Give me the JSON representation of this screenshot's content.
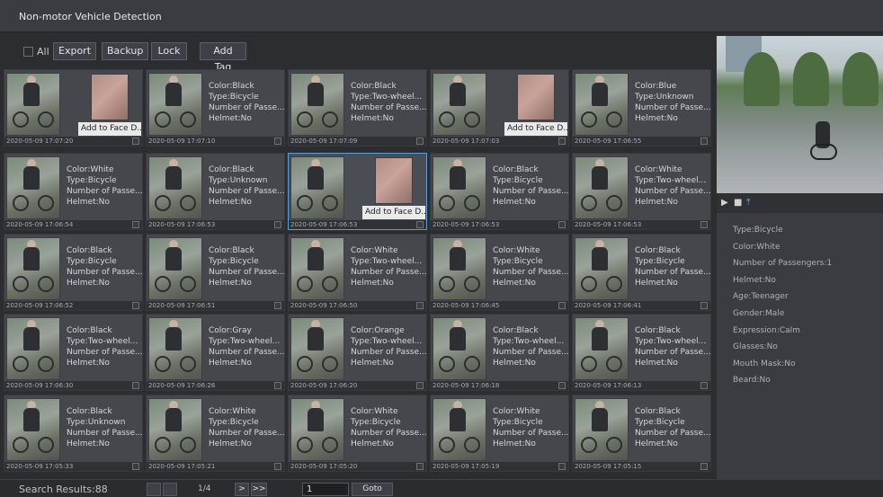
{
  "window": {
    "title": "Non-motor Vehicle Detection"
  },
  "toolbar": {
    "all_label": "All",
    "export_label": "Export",
    "backup_label": "Backup",
    "lock_label": "Lock",
    "add_tag_label": "Add Tag"
  },
  "grid": {
    "cells": [
      {
        "ts": "2020-05-09 17:07:20",
        "face": true,
        "face_label": "Add to Face D...",
        "info": []
      },
      {
        "ts": "2020-05-09 17:07:10",
        "face": false,
        "info": [
          "Color:Black",
          "Type:Bicycle",
          "Number of Passe...",
          "Helmet:No"
        ]
      },
      {
        "ts": "2020-05-09 17:07:09",
        "face": false,
        "info": [
          "Color:Black",
          "Type:Two-wheel...",
          "Number of Passe...",
          "Helmet:No"
        ]
      },
      {
        "ts": "2020-05-09 17:07:03",
        "face": true,
        "face_label": "Add to Face D...",
        "info": []
      },
      {
        "ts": "2020-05-09 17:06:55",
        "face": false,
        "info": [
          "Color:Blue",
          "Type:Unknown",
          "Number of Passe...",
          "Helmet:No"
        ]
      },
      {
        "ts": "2020-05-09 17:06:54",
        "face": false,
        "info": [
          "Color:White",
          "Type:Bicycle",
          "Number of Passe...",
          "Helmet:No"
        ]
      },
      {
        "ts": "2020-05-09 17:06:53",
        "face": false,
        "info": [
          "Color:Black",
          "Type:Unknown",
          "Number of Passe...",
          "Helmet:No"
        ]
      },
      {
        "ts": "2020-05-09 17:06:53",
        "face": true,
        "face_label": "Add to Face D...",
        "info": [],
        "selected": true
      },
      {
        "ts": "2020-05-09 17:06:53",
        "face": false,
        "info": [
          "Color:Black",
          "Type:Bicycle",
          "Number of Passe...",
          "Helmet:No"
        ]
      },
      {
        "ts": "2020-05-09 17:06:53",
        "face": false,
        "info": [
          "Color:White",
          "Type:Two-wheel...",
          "Number of Passe...",
          "Helmet:No"
        ]
      },
      {
        "ts": "2020-05-09 17:06:52",
        "face": false,
        "info": [
          "Color:Black",
          "Type:Bicycle",
          "Number of Passe...",
          "Helmet:No"
        ]
      },
      {
        "ts": "2020-05-09 17:06:51",
        "face": false,
        "info": [
          "Color:Black",
          "Type:Bicycle",
          "Number of Passe...",
          "Helmet:No"
        ]
      },
      {
        "ts": "2020-05-09 17:06:50",
        "face": false,
        "info": [
          "Color:White",
          "Type:Two-wheel...",
          "Number of Passe...",
          "Helmet:No"
        ]
      },
      {
        "ts": "2020-05-09 17:06:45",
        "face": false,
        "info": [
          "Color:White",
          "Type:Bicycle",
          "Number of Passe...",
          "Helmet:No"
        ]
      },
      {
        "ts": "2020-05-09 17:06:41",
        "face": false,
        "info": [
          "Color:Black",
          "Type:Bicycle",
          "Number of Passe...",
          "Helmet:No"
        ]
      },
      {
        "ts": "2020-05-09 17:06:30",
        "face": false,
        "info": [
          "Color:Black",
          "Type:Two-wheel...",
          "Number of Passe...",
          "Helmet:No"
        ]
      },
      {
        "ts": "2020-05-09 17:06:26",
        "face": false,
        "info": [
          "Color:Gray",
          "Type:Two-wheel...",
          "Number of Passe...",
          "Helmet:No"
        ]
      },
      {
        "ts": "2020-05-09 17:06:20",
        "face": false,
        "info": [
          "Color:Orange",
          "Type:Two-wheel...",
          "Number of Passe...",
          "Helmet:No"
        ]
      },
      {
        "ts": "2020-05-09 17:06:18",
        "face": false,
        "info": [
          "Color:Black",
          "Type:Two-wheel...",
          "Number of Passe...",
          "Helmet:No"
        ]
      },
      {
        "ts": "2020-05-09 17:06:13",
        "face": false,
        "info": [
          "Color:Black",
          "Type:Two-wheel...",
          "Number of Passe...",
          "Helmet:No"
        ]
      },
      {
        "ts": "2020-05-09 17:05:33",
        "face": false,
        "info": [
          "Color:Black",
          "Type:Unknown",
          "Number of Passe...",
          "Helmet:No"
        ]
      },
      {
        "ts": "2020-05-09 17:05:21",
        "face": false,
        "info": [
          "Color:White",
          "Type:Bicycle",
          "Number of Passe...",
          "Helmet:No"
        ]
      },
      {
        "ts": "2020-05-09 17:05:20",
        "face": false,
        "info": [
          "Color:White",
          "Type:Bicycle",
          "Number of Passe...",
          "Helmet:No"
        ]
      },
      {
        "ts": "2020-05-09 17:05:19",
        "face": false,
        "info": [
          "Color:White",
          "Type:Bicycle",
          "Number of Passe...",
          "Helmet:No"
        ]
      },
      {
        "ts": "2020-05-09 17:05:15",
        "face": false,
        "info": [
          "Color:Black",
          "Type:Bicycle",
          "Number of Passe...",
          "Helmet:No"
        ]
      }
    ]
  },
  "preview": {
    "controls": [
      "▶",
      "■",
      "⤒"
    ]
  },
  "details": [
    "Type:Bicycle",
    "Color:White",
    "Number of Passengers:1",
    "Helmet:No",
    "Age:Teenager",
    "Gender:Male",
    "Expression:Calm",
    "Glasses:No",
    "Mouth Mask:No",
    "Beard:No"
  ],
  "footer": {
    "search_results": "Search Results:88",
    "page_indicator": "1/4",
    "next_label": ">",
    "last_label": ">>",
    "page_input_value": "1",
    "goto_label": "Goto"
  }
}
